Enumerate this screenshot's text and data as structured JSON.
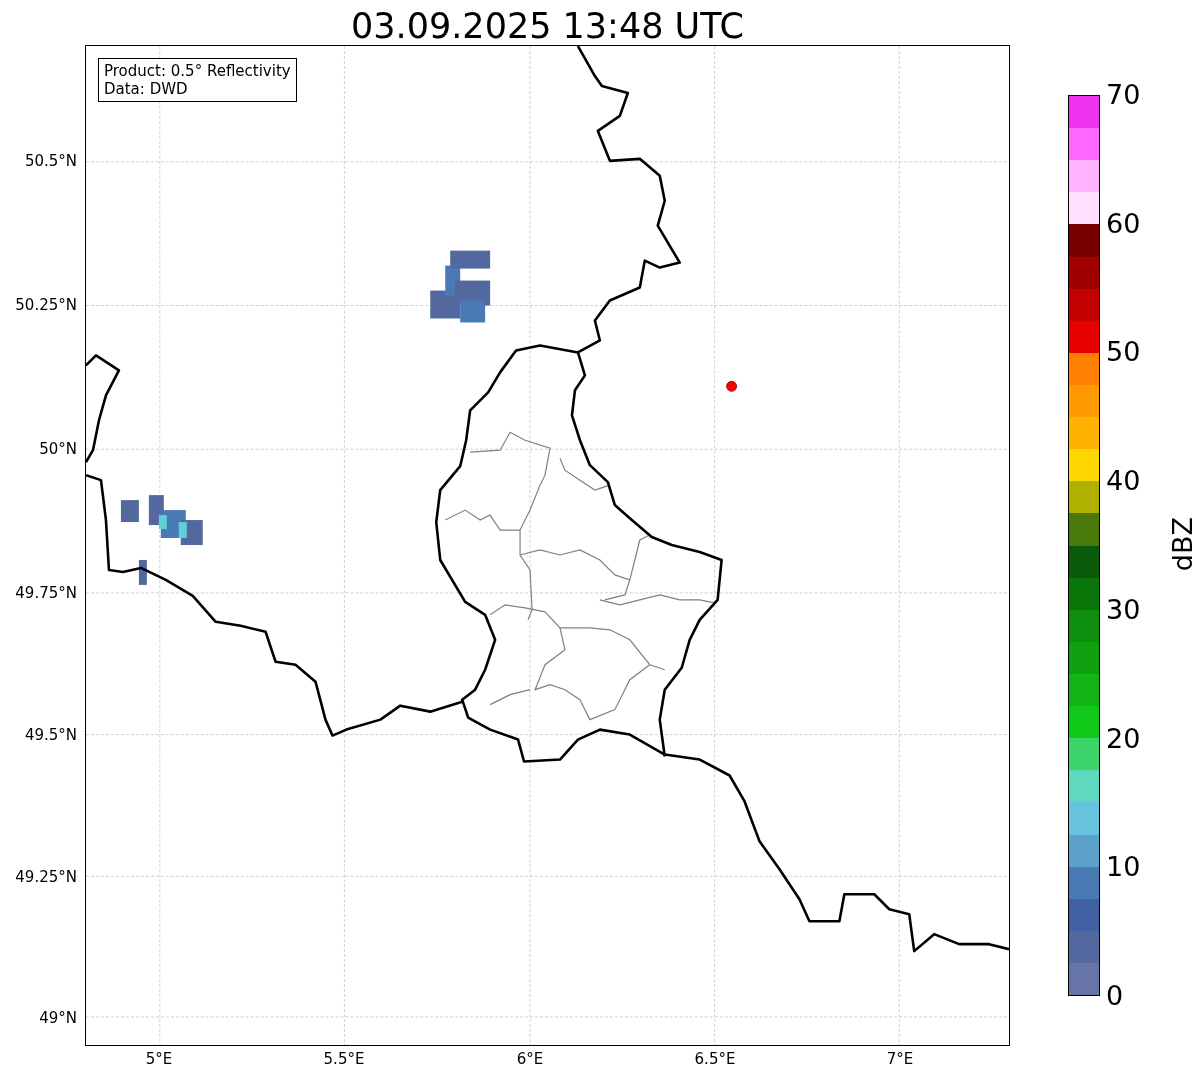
{
  "title": "03.09.2025 13:48 UTC",
  "info_box": [
    "Product: 0.5° Reflectivity",
    "Data: DWD"
  ],
  "map": {
    "lat_labels": [
      "50.5°N",
      "50.25°N",
      "50°N",
      "49.75°N",
      "49.5°N",
      "49.25°N",
      "49°N"
    ],
    "lon_labels": [
      "5°E",
      "5.5°E",
      "6°E",
      "6.5°E",
      "7°E"
    ]
  },
  "colorbar": {
    "label": "dBZ",
    "ticks": [
      "70",
      "60",
      "50",
      "40",
      "30",
      "20",
      "10",
      "0"
    ],
    "bins": [
      {
        "color": "#ee33ee"
      },
      {
        "color": "#ff66ff"
      },
      {
        "color": "#ffb3ff"
      },
      {
        "color": "#ffe0ff"
      },
      {
        "color": "#7a0000"
      },
      {
        "color": "#a00000"
      },
      {
        "color": "#c40000"
      },
      {
        "color": "#e60000"
      },
      {
        "color": "#ff7f00"
      },
      {
        "color": "#ff9900"
      },
      {
        "color": "#ffb300"
      },
      {
        "color": "#ffd700"
      },
      {
        "color": "#b0b000"
      },
      {
        "color": "#4a7a0a"
      },
      {
        "color": "#0a5a0a"
      },
      {
        "color": "#0a760a"
      },
      {
        "color": "#0e8f0e"
      },
      {
        "color": "#0fa010"
      },
      {
        "color": "#12b515"
      },
      {
        "color": "#10c818"
      },
      {
        "color": "#3dd46b"
      },
      {
        "color": "#60d8c0"
      },
      {
        "color": "#66c2dd"
      },
      {
        "color": "#5aa0c8"
      },
      {
        "color": "#4a7ab4"
      },
      {
        "color": "#4260a4"
      },
      {
        "color": "#52689e"
      },
      {
        "color": "#6674a8"
      }
    ]
  }
}
